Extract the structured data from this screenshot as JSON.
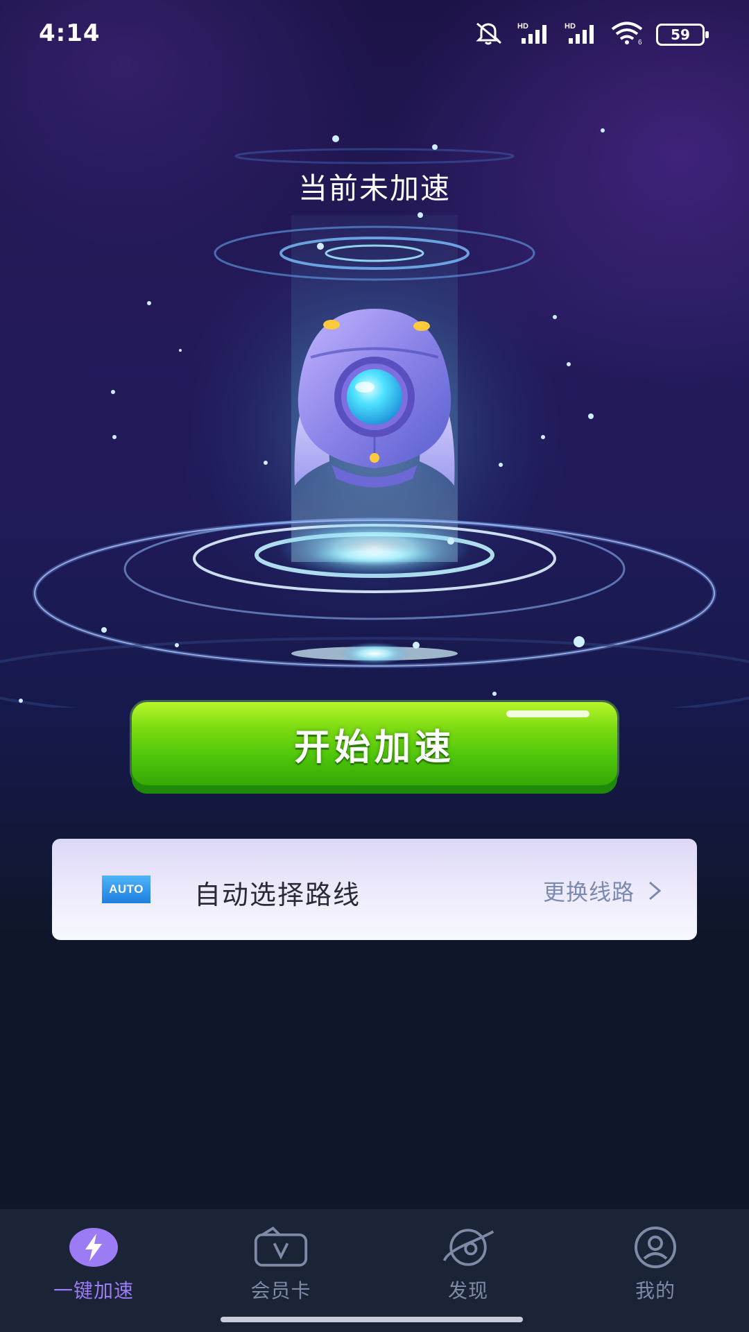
{
  "status_bar": {
    "time": "4:14",
    "battery": "59",
    "icons": [
      "mute-icon",
      "hd-signal-icon",
      "hd-signal-icon",
      "wifi-icon",
      "battery-icon"
    ]
  },
  "page": {
    "title": "当前未加速",
    "start_button_label": "开始加速"
  },
  "route_card": {
    "badge": "AUTO",
    "label": "自动选择路线",
    "change_label": "更换线路"
  },
  "bottom_nav": {
    "items": [
      {
        "label": "一键加速",
        "icon": "lightning-icon",
        "active": true
      },
      {
        "label": "会员卡",
        "icon": "vip-card-icon",
        "active": false
      },
      {
        "label": "发现",
        "icon": "planet-icon",
        "active": false
      },
      {
        "label": "我的",
        "icon": "user-profile-icon",
        "active": false
      }
    ]
  },
  "colors": {
    "accent_green": "#4ec60a",
    "nav_active": "#9b7cf5",
    "nav_inactive": "#7f8aa6",
    "background": "#10162a"
  }
}
